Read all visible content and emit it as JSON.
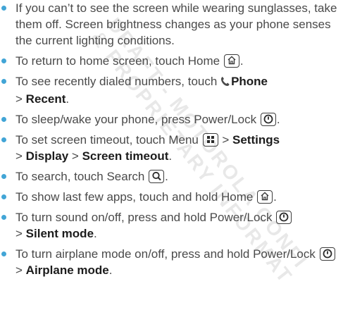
{
  "tips": [
    {
      "line1": "If you can’t to see the screen while wearing sunglasses, take them off. Screen brightness changes as your phone senses the current lighting conditions."
    },
    {
      "text1": "To return to home screen, touch Home",
      "text2": "."
    },
    {
      "text1": "To see recently dialed numbers, touch",
      "bold1": "Phone",
      "sep": ">",
      "bold2": "Recent",
      "text2": "."
    },
    {
      "text1": "To sleep/wake your phone, press Power/Lock",
      "text2": "."
    },
    {
      "text1": "To set screen timeout, touch Menu",
      "sep1": ">",
      "bold1": "Settings",
      "sep2": ">",
      "bold2": "Display",
      "sep3": ">",
      "bold3": "Screen timeout",
      "text2": "."
    },
    {
      "text1": "To search, touch Search",
      "text2": "."
    },
    {
      "text1": "To show last few apps, touch and hold Home",
      "text2": "."
    },
    {
      "text1": "To turn sound on/off, press and hold Power/Lock",
      "sep": ">",
      "bold1": "Silent mode",
      "text2": "."
    },
    {
      "text1": "To turn airplane mode on/off, press and hold Power/Lock",
      "sep": ">",
      "bold1": "Airplane mode",
      "text2": "."
    }
  ],
  "watermark": {
    "line1": "DRAFT - MOTOROLA CONFI",
    "line2": "& PROPRIETARY INFORMAT"
  },
  "icons": {
    "home": "home-key-icon",
    "power": "power-lock-key-icon",
    "menu": "menu-key-icon",
    "search": "search-key-icon",
    "phone": "phone-handset-icon"
  },
  "colors": {
    "bullet": "#42a5d6",
    "text": "#4a4a4a",
    "bold": "#1c1c1c"
  }
}
